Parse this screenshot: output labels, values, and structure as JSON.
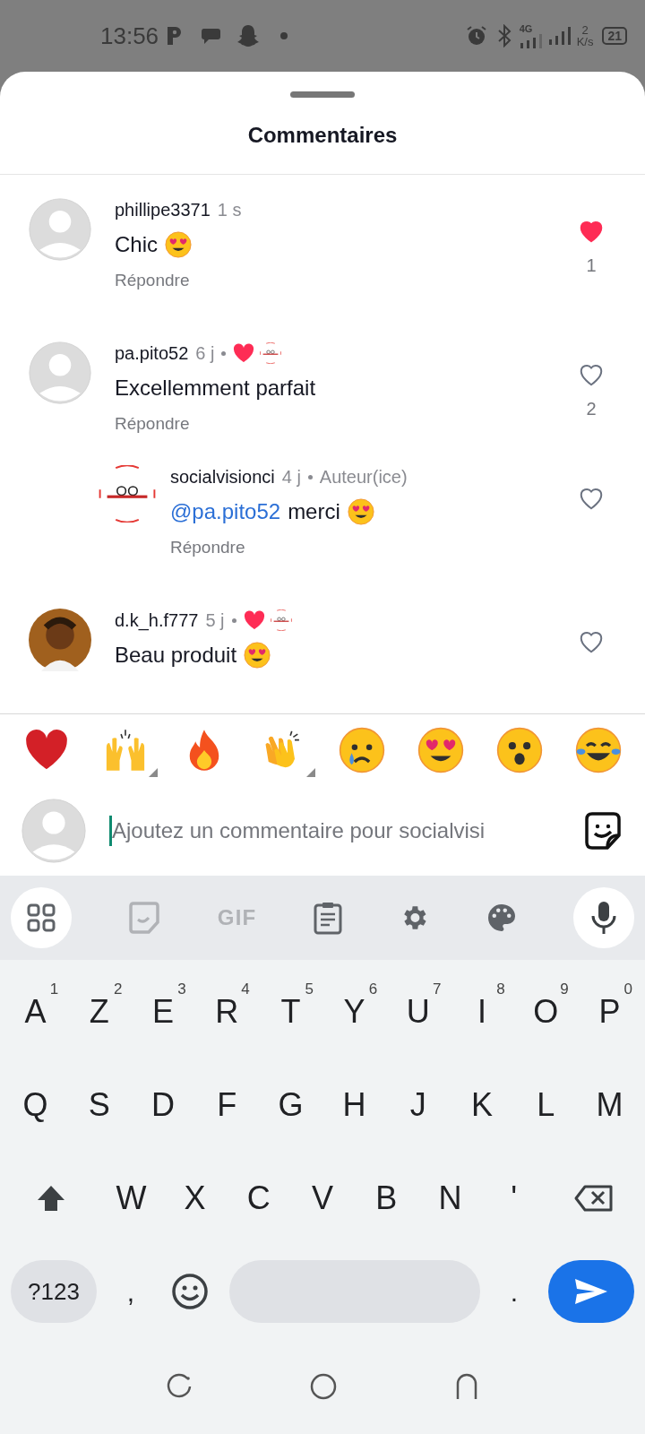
{
  "status_bar": {
    "time": "13:56",
    "network": "4G",
    "speed_value": "2",
    "speed_unit": "K/s",
    "battery": "21"
  },
  "sheet": {
    "title": "Commentaires"
  },
  "comments": [
    {
      "user": "phillipe3371",
      "time": "1 s",
      "text": "Chic",
      "emoji": {
        "kind": "heart_eyes"
      },
      "reply": "Répondre",
      "liked": true,
      "likes": "1",
      "avatar": {
        "kind": "default"
      },
      "author_liked": false
    },
    {
      "user": "pa.pito52",
      "time": "6 j",
      "text": "Excellemment parfait",
      "reply": "Répondre",
      "liked": false,
      "likes": "2",
      "avatar": {
        "kind": "default"
      },
      "author_liked": true,
      "children": [
        {
          "user": "socialvisionci",
          "time": "4 j",
          "badge": "Auteur(ice)",
          "mention": "@pa.pito52",
          "text": "merci",
          "emoji": {
            "kind": "heart_eyes"
          },
          "reply": "Répondre",
          "liked": false,
          "avatar": {
            "kind": "logo"
          },
          "author_liked": false
        }
      ]
    },
    {
      "user": "d.k_h.f777",
      "time": "5 j",
      "text": "Beau produit",
      "emoji": {
        "kind": "heart_eyes"
      },
      "liked": false,
      "avatar": {
        "kind": "figure"
      },
      "author_liked": true
    }
  ],
  "reactions": [
    {
      "kind": "heart",
      "variants": false
    },
    {
      "kind": "raised_hands",
      "variants": true
    },
    {
      "kind": "fire",
      "variants": false
    },
    {
      "kind": "clap",
      "variants": true
    },
    {
      "kind": "cry",
      "variants": false
    },
    {
      "kind": "heart_eyes",
      "variants": false
    },
    {
      "kind": "wow",
      "variants": false
    },
    {
      "kind": "laugh",
      "variants": false
    }
  ],
  "composer": {
    "placeholder": "Ajoutez un commentaire pour socialvisi"
  },
  "keyboard": {
    "toolbar": [
      {
        "kind": "apps"
      },
      {
        "kind": "sticker"
      },
      {
        "kind": "gif",
        "label": "GIF"
      },
      {
        "kind": "clipboard"
      },
      {
        "kind": "settings"
      },
      {
        "kind": "palette"
      },
      {
        "kind": "mic"
      }
    ],
    "letter_rows": [
      {
        "keys": [
          {
            "kind": "char",
            "label": "A",
            "hint": "1"
          },
          {
            "kind": "char",
            "label": "Z",
            "hint": "2"
          },
          {
            "kind": "char",
            "label": "E",
            "hint": "3"
          },
          {
            "kind": "char",
            "label": "R",
            "hint": "4"
          },
          {
            "kind": "char",
            "label": "T",
            "hint": "5"
          },
          {
            "kind": "char",
            "label": "Y",
            "hint": "6"
          },
          {
            "kind": "char",
            "label": "U",
            "hint": "7"
          },
          {
            "kind": "char",
            "label": "I",
            "hint": "8"
          },
          {
            "kind": "char",
            "label": "O",
            "hint": "9"
          },
          {
            "kind": "char",
            "label": "P",
            "hint": "0"
          }
        ]
      },
      {
        "keys": [
          {
            "kind": "char",
            "label": "Q"
          },
          {
            "kind": "char",
            "label": "S"
          },
          {
            "kind": "char",
            "label": "D"
          },
          {
            "kind": "char",
            "label": "F"
          },
          {
            "kind": "char",
            "label": "G"
          },
          {
            "kind": "char",
            "label": "H"
          },
          {
            "kind": "char",
            "label": "J"
          },
          {
            "kind": "char",
            "label": "K"
          },
          {
            "kind": "char",
            "label": "L"
          },
          {
            "kind": "char",
            "label": "M"
          }
        ]
      },
      {
        "keys": [
          {
            "kind": "shift"
          },
          {
            "kind": "char",
            "label": "W"
          },
          {
            "kind": "char",
            "label": "X"
          },
          {
            "kind": "char",
            "label": "C"
          },
          {
            "kind": "char",
            "label": "V"
          },
          {
            "kind": "char",
            "label": "B"
          },
          {
            "kind": "char",
            "label": "N"
          },
          {
            "kind": "char",
            "label": "'"
          },
          {
            "kind": "backspace"
          }
        ]
      }
    ],
    "bottom_row": {
      "symbols": "?123",
      "comma": ",",
      "period": "."
    }
  }
}
